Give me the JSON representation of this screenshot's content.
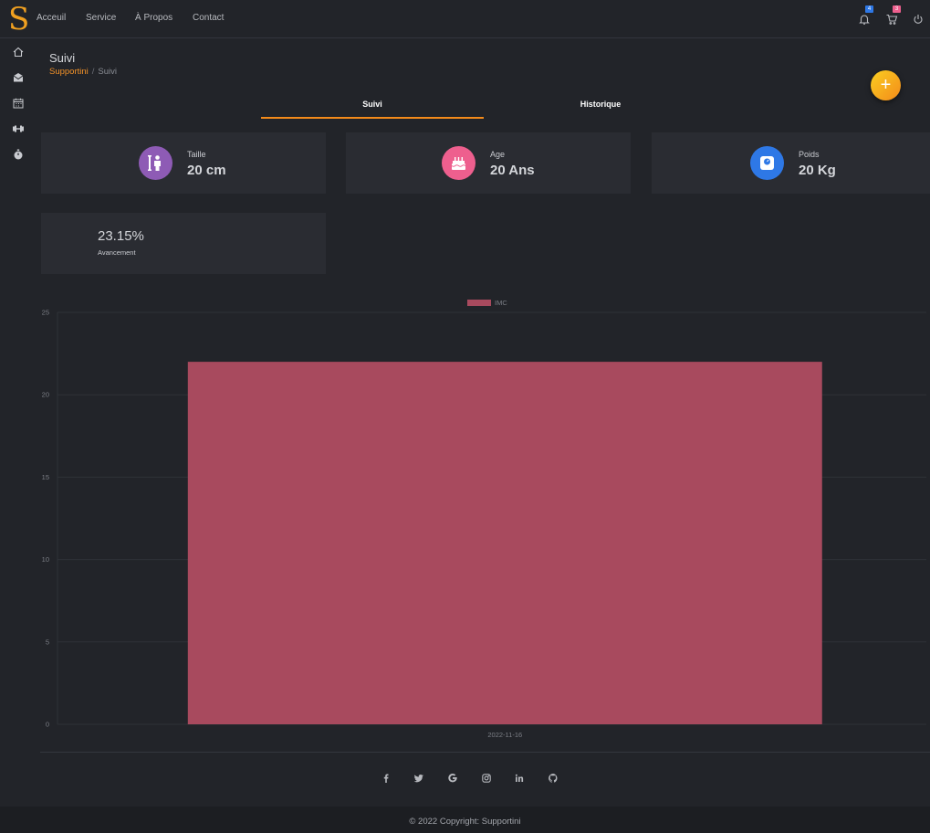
{
  "brand": {
    "logo_letter": "S",
    "color": "#f0a020"
  },
  "nav": {
    "links": [
      "Acceuil",
      "Service",
      "À Propos",
      "Contact"
    ],
    "notifications_count": "4",
    "cart_count": "3",
    "icons": [
      "bell-icon",
      "cart-icon",
      "power-icon"
    ]
  },
  "sidebar": {
    "icons": [
      "home-icon",
      "mail-icon",
      "calendar-icon",
      "dumbbell-icon",
      "stopwatch-icon"
    ]
  },
  "page": {
    "title": "Suivi",
    "breadcrumb": {
      "home": "Supportini",
      "current": "Suivi"
    },
    "add_button": "+"
  },
  "tabs": [
    {
      "label": "Suivi",
      "active": true
    },
    {
      "label": "Historique",
      "active": false
    }
  ],
  "stats": {
    "taille": {
      "label": "Taille",
      "value": "20 cm",
      "color": "#8e5bb5",
      "icon": "person-height-icon"
    },
    "age": {
      "label": "Age",
      "value": "20 Ans",
      "color": "#ee5f8e",
      "icon": "birthday-cake-icon"
    },
    "poids": {
      "label": "Poids",
      "value": "20 Kg",
      "color": "#2e78e6",
      "icon": "scale-icon"
    },
    "avancement": {
      "label": "Avancement",
      "value": "23.15%"
    }
  },
  "chart_data": {
    "type": "bar",
    "categories": [
      "2022-11-16"
    ],
    "series": [
      {
        "name": "IMC",
        "values": [
          22
        ],
        "color": "#a84a5e"
      }
    ],
    "ylim": [
      0,
      25
    ],
    "yticks": [
      0,
      5,
      10,
      15,
      20,
      25
    ],
    "legend": "top",
    "grid": true
  },
  "footer": {
    "social": [
      "facebook-icon",
      "twitter-icon",
      "google-icon",
      "instagram-icon",
      "linkedin-icon",
      "github-icon"
    ],
    "copyright": "© 2022 Copyright: Supportini"
  }
}
